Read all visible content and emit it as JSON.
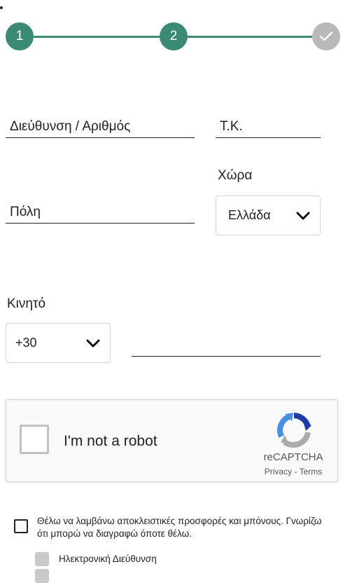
{
  "stepper": {
    "steps": [
      {
        "label": "1",
        "state": "active"
      },
      {
        "label": "2",
        "state": "active"
      },
      {
        "label": "",
        "icon": "check-icon",
        "state": "pending"
      }
    ],
    "active_color": "#3a8a74",
    "pending_color": "#b9b9b9"
  },
  "form": {
    "address_placeholder": "Διεύθυνση / Αριθμός",
    "zip_placeholder": "Τ.Κ.",
    "city_placeholder": "Πόλη",
    "country_label": "Χώρα",
    "country_value": "Ελλάδα",
    "mobile_label": "Κινητό",
    "phone_code_value": "+30",
    "mobile_placeholder": ""
  },
  "recaptcha": {
    "checkbox_label": "I'm not a robot",
    "brand": "reCAPTCHA",
    "privacy": "Privacy",
    "separator": " - ",
    "terms": "Terms",
    "icon": "recaptcha-logo-icon"
  },
  "newsletter": {
    "text": "Θέλω να λαμβάνω αποκλειστικές προσφορές και μπόνους. Γνωρίζω ότι μπορώ να διαγραφώ όποτε θέλω.",
    "options": [
      {
        "label": "Ηλεκτρονική Διεύθυνση"
      }
    ]
  }
}
